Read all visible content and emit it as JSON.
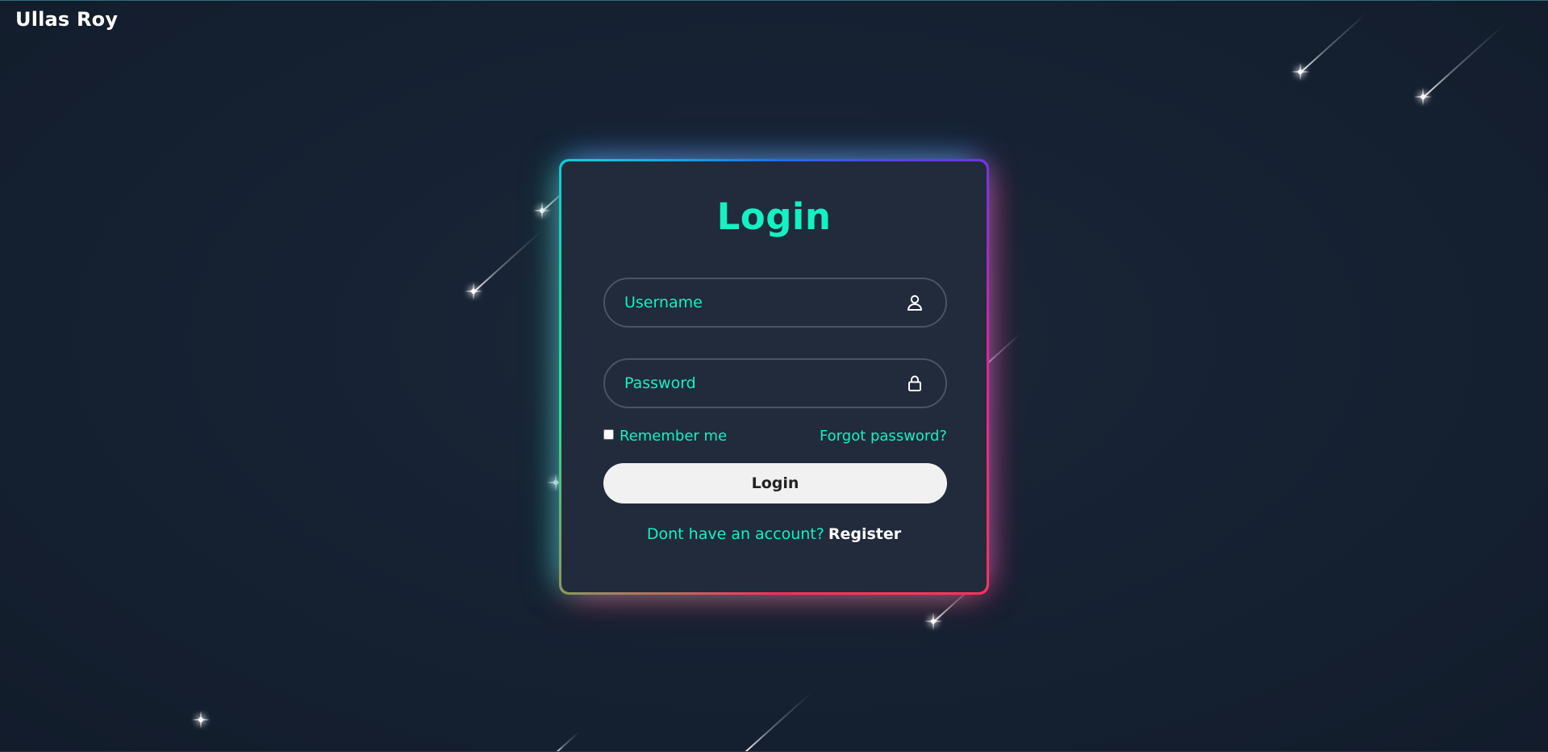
{
  "brand": {
    "name": "Ullas Roy"
  },
  "login_form": {
    "title": "Login",
    "username": {
      "placeholder": "Username",
      "value": "",
      "icon": "user-icon"
    },
    "password": {
      "placeholder": "Password",
      "value": "",
      "icon": "lock-icon"
    },
    "remember_me_label": "Remember me",
    "remember_me_checked": false,
    "forgot_password_label": "Forgot password?",
    "submit_label": "Login",
    "register_prompt": "Dont have an account?",
    "register_link_label": "Register"
  },
  "colors": {
    "accent": "#14f1c2",
    "background": "#162233",
    "card": "#212b3c",
    "button": "#f1f1f1"
  }
}
